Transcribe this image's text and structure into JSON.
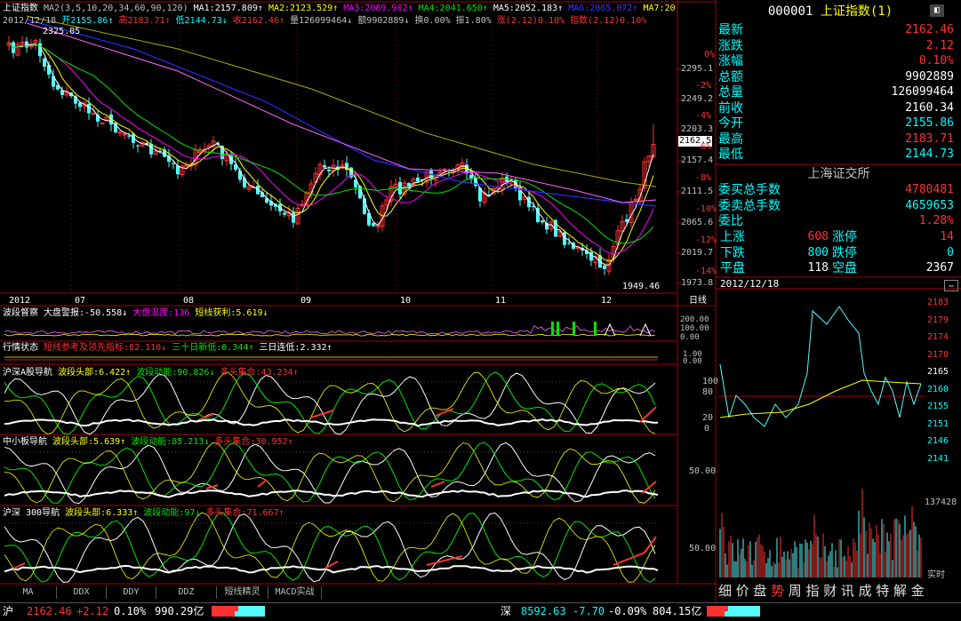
{
  "colors": {
    "up": "#ff3232",
    "down": "#54fcfc",
    "bg": "#000000",
    "grid": "#aa0000",
    "ma1": "#ffffff",
    "ma2": "#ffff00",
    "ma3": "#ff00ff",
    "ma4": "#00e600",
    "ma5": "#0000ff",
    "ma6": "#aaaa00",
    "ma7": "#ff88ff"
  },
  "main": {
    "line1": {
      "name": "上证指数",
      "ma_params": "MA2(3,5,10,20,34,60,90,120)",
      "ma1": "MA1:2157.809↑",
      "ma2": "MA2:2123.529↑",
      "ma3": "MA3:2089.902↑",
      "ma4": "MA4:2041.650↑",
      "ma5": "MA5:2052.183↑",
      "ma6": "MA6:2065.072↑",
      "ma7": "MA7:20"
    },
    "line2": {
      "date": "2012/12/18",
      "open": "开2155.86↑",
      "high": "高2183.71↑",
      "low": "低2144.73↓",
      "close": "收2162.46↑",
      "vol": "量126099464↓",
      "amt": "额9902889↓",
      "turn": "换0.00%",
      "amp": "振1.80%",
      "chg": "涨(2.12)0.10%",
      "idx": "指数(2.12)0.10%"
    },
    "high_label": "2325.05",
    "low_label": "1949.46",
    "current_price": "2162.5",
    "price_axis": [
      "2295.1",
      "2249.2",
      "2203.3",
      "2157.4",
      "2111.5",
      "2065.6",
      "2019.7",
      "1973.8"
    ],
    "pct_axis": [
      "0%",
      "-2%",
      "-4%",
      "-6%",
      "-8%",
      "-10%",
      "-12%",
      "-14%"
    ],
    "months": [
      "2012",
      "07",
      "08",
      "09",
      "10",
      "11",
      "12"
    ],
    "cycle": "日线"
  },
  "panels": {
    "p1": {
      "title": "波段督察",
      "a": "大盘警报:-50.558↓",
      "b": "大盘温度:136",
      "c": "短线获利:5.619↓",
      "axis": [
        "200.00",
        "100.00",
        "0.00"
      ]
    },
    "p2": {
      "title": "行情状态",
      "a": "短线参考及领先指标:82.110↓",
      "b": "三十日新低:0.344↑",
      "c": "三日连低:2.332↑",
      "axis": [
        "1.00",
        "0.00"
      ]
    },
    "p3": {
      "title": "沪深A股导航",
      "a": "波段头部:6.422↑",
      "b": "波段动能:90.826↓",
      "c": "多头集合:43.234↑",
      "axis": [
        "100",
        "80",
        "20",
        "0"
      ]
    },
    "p4": {
      "title": "中小板导航",
      "a": "波段头部:5.639↑",
      "b": "波段动能:85.213↓",
      "c": "多头集合:30.952↑",
      "axis": [
        "50.00"
      ]
    },
    "p5": {
      "title": "沪深 300导航",
      "a": "波段头部:6.333↑",
      "b": "波段动能:97↓",
      "c": "多头集合:71.667↑",
      "axis": [
        "50.00"
      ]
    }
  },
  "tabs": [
    "MA",
    "DDX",
    "DDY",
    "DDZ",
    "短线精灵",
    "MACD实战"
  ],
  "quote": {
    "code": "000001",
    "name": "上证指数",
    "suffix": "(1)",
    "rows1": [
      {
        "label": "最新",
        "value": "2162.46",
        "color": "#ff3232"
      },
      {
        "label": "涨跌",
        "value": "2.12",
        "color": "#ff3232"
      },
      {
        "label": "涨幅",
        "value": "0.10%",
        "color": "#ff3232"
      },
      {
        "label": "总额",
        "value": "9902889",
        "color": "#ffffff"
      },
      {
        "label": "总量",
        "value": "126099464",
        "color": "#ffffff"
      },
      {
        "label": "前收",
        "value": "2160.34",
        "color": "#ffffff"
      },
      {
        "label": "今开",
        "value": "2155.86",
        "color": "#00ffff"
      },
      {
        "label": "最高",
        "value": "2183.71",
        "color": "#ff3232"
      },
      {
        "label": "最低",
        "value": "2144.73",
        "color": "#00ffff"
      }
    ],
    "exchange": "上海证交所",
    "rows2": [
      {
        "label": "委买总手数",
        "value": "4780481",
        "color": "#ff3232"
      },
      {
        "label": "委卖总手数",
        "value": "4659653",
        "color": "#00ffff"
      },
      {
        "label": "委比",
        "value": "1.28%",
        "color": "#ff3232"
      }
    ],
    "breadth": [
      {
        "l1": "上涨",
        "v1": "608",
        "c1": "#ff3232",
        "l2": "涨停",
        "v2": "14",
        "c2": "#ff3232"
      },
      {
        "l1": "下跌",
        "v1": "800",
        "c1": "#00ffff",
        "l2": "跌停",
        "v2": "0",
        "c2": "#00ffff"
      },
      {
        "l1": "平盘",
        "v1": "118",
        "c1": "#ffffff",
        "l2": "空盘",
        "v2": "2367",
        "c2": "#ffffff"
      }
    ]
  },
  "intraday": {
    "date": "2012/12/18",
    "price_axis": [
      "2183",
      "2179",
      "2174",
      "2170",
      "2165",
      "2160",
      "2155",
      "2151",
      "2146",
      "2141"
    ],
    "vol_max": "137428",
    "label": "实时"
  },
  "right_tabs": [
    "细",
    "价",
    "盘",
    "势",
    "周",
    "指",
    "财",
    "讯",
    "成",
    "特",
    "解",
    "金"
  ],
  "status": {
    "sh_label": "沪",
    "sh_price": "2162.46",
    "sh_chg": "+2.12",
    "sh_pct": "0.10%",
    "sh_amt": "990.29亿",
    "sz_label": "深",
    "sz_price": "8592.63",
    "sz_chg": "-7.70",
    "sz_pct": "-0.09%",
    "sz_amt": "804.15亿"
  }
}
